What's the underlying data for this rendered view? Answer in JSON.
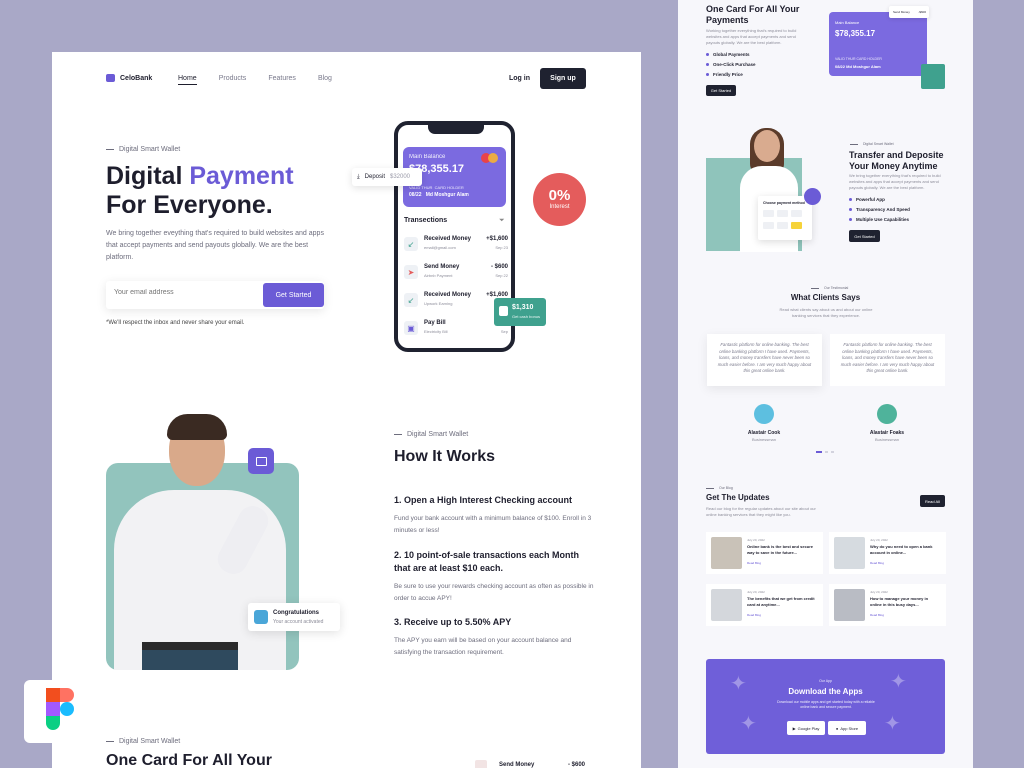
{
  "brand": {
    "name": "CeloBank",
    "accent": "#6b5bd6",
    "dark": "#1f2230",
    "teal": "#92c4bd"
  },
  "nav": {
    "items": [
      "Home",
      "Products",
      "Features",
      "Blog"
    ],
    "login": "Log in",
    "signup": "Sign up"
  },
  "hero": {
    "eyebrow": "Digital Smart Wallet",
    "title_a": "Digital ",
    "title_accent": "Payment",
    "title_b": "For Everyone.",
    "description": "We bring together eveything that's required to build websites and apps that accept payments and send payouts globally. We are the best platform.",
    "email_placeholder": "Your email address",
    "cta": "Get Started",
    "note": "*We'll respect the inbox and never share your email."
  },
  "phone": {
    "balance_label": "Main Balance",
    "balance": "$78,355.17",
    "valid_label": "VALID THUR",
    "holder_label": "CARD HOLDER",
    "valid": "08/22",
    "holder": "Md Moshgur Alam",
    "tx_title": "Transections",
    "transactions": [
      {
        "title": "Received Money",
        "sub": "email@gmail.com",
        "amount": "+$1,600",
        "date": "Sep 23"
      },
      {
        "title": "Send Money",
        "sub": "Airbnb Payment",
        "amount": "- $600",
        "date": "Sep 22"
      },
      {
        "title": "Received Money",
        "sub": "Upwork Earning",
        "amount": "+$1,600",
        "date": "Sep 22"
      },
      {
        "title": "Pay Bill",
        "sub": "Electricity Bill",
        "amount": "- $",
        "date": "Sep"
      }
    ]
  },
  "deposit": {
    "label": "Deposit",
    "amount": "$32000"
  },
  "interest": {
    "value": "0%",
    "label": "Interest"
  },
  "cashback": {
    "value": "$1,310",
    "sub": "Get cash bonus"
  },
  "congrats": {
    "title": "Congratulations",
    "sub": "Your account activated"
  },
  "how": {
    "eyebrow": "Digital Smart Wallet",
    "title": "How It Works",
    "steps": [
      {
        "title": "1. Open a High Interest Checking account",
        "desc": "Fund your bank account with a minimum balance of $100. Enroll in 3 minutes or less!"
      },
      {
        "title": "2. 10 point-of-sale transactions each Month that are at least $10 each.",
        "desc": "Be sure to use your rewards checking account as often as possible in order to accue APY!"
      },
      {
        "title": "3. Receive up to 5.50% APY",
        "desc": "The APY you earn will be based on your account balance and satisfying the transaction requirement."
      }
    ]
  },
  "card_section": {
    "eyebrow": "Digital Smart Wallet",
    "title": "One Card For All Your",
    "peek_title": "Send Money",
    "peek_amount": "- $600"
  },
  "right": {
    "card_title": "One Card For All Your Payments",
    "card_desc": "Working together everything that's required to build websites and apps that accept payments and send payouts globally. We are the best platform.",
    "card_bullets": [
      "Global Payments",
      "One-Click Purchase",
      "Friendly Price"
    ],
    "card_btn": "Get Started",
    "mini_card": {
      "label": "Main Balance",
      "value": "$78,355.17",
      "meta": "VALID THUR   CARD HOLDER",
      "meta2": "08/22      Md Moshgur Alam"
    },
    "mini_float": "Send Money",
    "mini_float_amt": "-$600",
    "transfer_eyebrow": "Digital Smart Wallet",
    "transfer_title": "Transfer and Deposite Your Money Anytime",
    "transfer_desc": "We bring together everything that's required to build websites and apps that accept payments and send payouts globally. We are the best platform.",
    "transfer_bullets": [
      "Powerful App",
      "Transparency And Speed",
      "Multiple Use Capabilities"
    ],
    "transfer_btn": "Get Started",
    "pay_title": "Choose payment method",
    "clients_eyebrow": "Our Testimonial",
    "clients_title": "What Clients Says",
    "clients_desc": "Read what clients say about us and about our online banking services that they experience.",
    "testimonial": "Fantastic platform for online banking. The best online banking platform I have used. Payments, loans, and money transfers have never been so much easier before. I am very much happy about this great online bank.",
    "clients": [
      {
        "name": "Alastair Cook",
        "role": "Businessman"
      },
      {
        "name": "Alastair Foaks",
        "role": "Businessman"
      }
    ],
    "blog_eyebrow": "Our Blog",
    "blog_title": "Get The Updates",
    "blog_desc": "Read our blog for the regular updates about our site about our online banking services that they might like you.",
    "blog_btn": "Read All",
    "posts": [
      {
        "date": "July 20, 2022",
        "title": "Online bank is the best and secure way to save in the future...",
        "read": "Read Blog"
      },
      {
        "date": "July 20, 2022",
        "title": "Why do you need to open a bank account in online...",
        "read": "Read Blog"
      },
      {
        "date": "July 20, 2022",
        "title": "The benefits that we get from credit card at anytime...",
        "read": "Read Blog"
      },
      {
        "date": "July 20, 2022",
        "title": "How to manage your money in online in this busy days...",
        "read": "Read Blog"
      }
    ],
    "apps_eyebrow": "Our App",
    "apps_title": "Download the Apps",
    "apps_desc": "Download our mobile apps and get started today with a reliable online bank and secure payment.",
    "store_google": "Google Play",
    "store_apple": "App Store"
  }
}
